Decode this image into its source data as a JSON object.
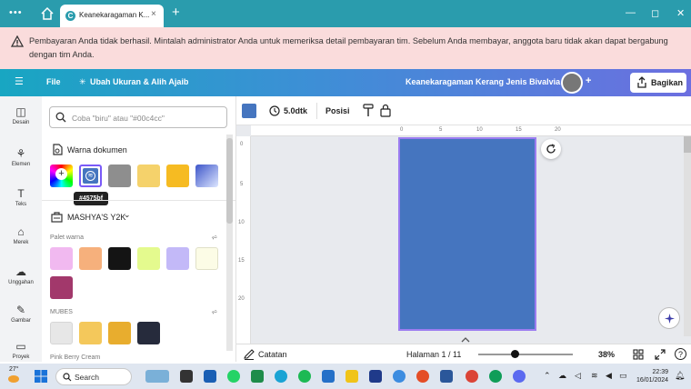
{
  "browser": {
    "tab_title": "Keanekaragaman K...",
    "tab_logo": "C",
    "menu_dots": "•••",
    "plus": "+",
    "close_x": "×",
    "minimize": "—",
    "restore": "◻",
    "close": "✕"
  },
  "banner": {
    "text": "Pembayaran Anda tidak berhasil. Mintalah administrator Anda untuk memeriksa detail pembayaran tim. Sebelum Anda membayar, anggota baru tidak akan dapat bergabung dengan tim Anda."
  },
  "toolbar": {
    "menu_icon": "☰",
    "file": "File",
    "resize": "Ubah Ukuran & Alih Ajaib",
    "doc_title": "Keanekaragaman Kerang Jenis Bivalvia",
    "avatar_plus": "+",
    "share": "Bagikan"
  },
  "rail": [
    {
      "label": "Desain",
      "icon": "◫"
    },
    {
      "label": "Elemen",
      "icon": "⚘"
    },
    {
      "label": "Teks",
      "icon": "T"
    },
    {
      "label": "Merek",
      "icon": "⌂"
    },
    {
      "label": "Unggahan",
      "icon": "☁"
    },
    {
      "label": "Gambar",
      "icon": "✎"
    },
    {
      "label": "Proyek",
      "icon": "▭"
    }
  ],
  "panel": {
    "search_placeholder": "Coba \"biru\" atau \"#00c4cc\"",
    "doc_colors_title": "Warna dokumen",
    "tooltip": "#4575bf",
    "brand_kit_title": "MASHYA'S Y2K",
    "brand_chevron": "⌄",
    "palette_label": "Palet warna",
    "mubes_label": "MUBES",
    "pink_label": "Pink Berry Cream",
    "plus": "+",
    "doc_colors": [
      "#4575bf",
      "#8e8e8e",
      "#f5d26b",
      "#f6bb22"
    ],
    "palette_colors": [
      "#f1b9f0",
      "#f6b07c",
      "#141414",
      "#e4fa8e",
      "#c3b9f8",
      "#fcfce6",
      "#a2386b"
    ],
    "mubes_colors": [
      "#e7e7e7",
      "#f4c85b",
      "#e8ad2e",
      "#262b3c"
    ]
  },
  "ctxbar": {
    "duration": "5.0dtk",
    "position": "Posisi",
    "current_color": "#4575bf"
  },
  "ruler": {
    "top": [
      "0",
      "5",
      "10",
      "15",
      "20"
    ],
    "left": [
      "0",
      "5",
      "10",
      "15",
      "20"
    ]
  },
  "page_color": "#4575bf",
  "bottombar": {
    "notes": "Catatan",
    "page_indicator": "Halaman 1 / 11",
    "zoom_percent": "38%",
    "zoom_fraction": 0.38,
    "help": "?"
  },
  "taskbar": {
    "weather": "27°",
    "search": "Search",
    "time": "22:39",
    "date": "16/01/2024"
  }
}
